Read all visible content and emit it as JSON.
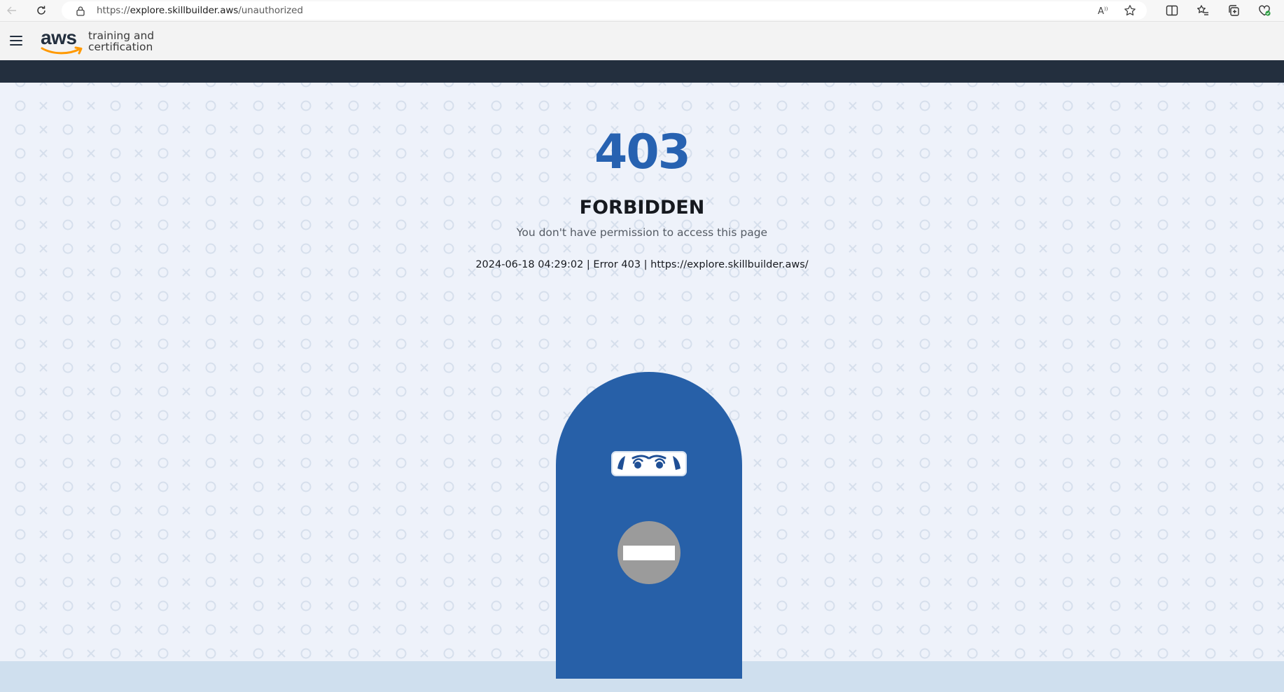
{
  "browser": {
    "url_prefix": "https://",
    "url_host": "explore.skillbuilder.aws",
    "url_path": "/unauthorized",
    "icons": [
      "back-arrow-icon",
      "refresh-icon",
      "lock-icon",
      "read-aloud-icon",
      "favorite-star-icon",
      "split-screen-icon",
      "favorites-icon",
      "collections-icon",
      "browser-essentials-icon"
    ]
  },
  "header": {
    "logo_brand": "aws",
    "logo_line1": "training and",
    "logo_line2": "certification",
    "menu_icon": "hamburger-menu-icon"
  },
  "error": {
    "code": "403",
    "title": "FORBIDDEN",
    "message": "You don't have permission to access this page",
    "details": "2024-06-18 04:29:02 | Error 403 | https://explore.skillbuilder.aws/"
  },
  "illustration": {
    "name": "guard-door-illustration",
    "icons": [
      "peeking-eyes-icon",
      "no-entry-sign-icon"
    ]
  },
  "colors": {
    "accent_blue": "#2762b1",
    "door_blue": "#2760a8",
    "dark_band": "#232f3e",
    "page_bg": "#eef2fa",
    "footer_band": "#cfdfee",
    "pattern": "#d6dfec",
    "aws_smile": "#ff9900"
  }
}
